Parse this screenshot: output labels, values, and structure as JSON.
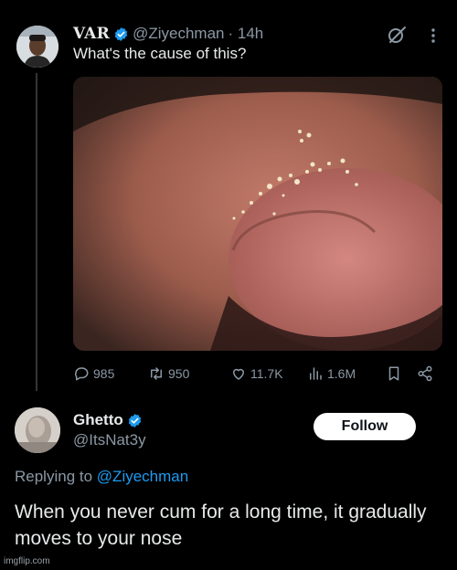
{
  "tweet": {
    "author_name": "VAR",
    "handle": "@Ziyechman",
    "time": "· 14h",
    "text": "What's the cause of this?",
    "stats": {
      "replies": "985",
      "retweets": "950",
      "likes": "11.7K",
      "views": "1.6M"
    }
  },
  "reply": {
    "author_name": "Ghetto",
    "handle": "@ItsNat3y",
    "follow_label": "Follow",
    "replying_prefix": "Replying to",
    "replying_mention": "@Ziyechman",
    "text": "When you never cum for a long time, it gradually moves to your nose"
  },
  "watermark": "imgflip.com",
  "colors": {
    "background": "#000000",
    "text_primary": "#e7e9ea",
    "text_secondary": "#8b98a5",
    "accent": "#1d9bf0",
    "verified": "#1d9bf0"
  },
  "icons": [
    "verified-badge-icon",
    "grok-icon",
    "more-icon",
    "reply-icon",
    "retweet-icon",
    "like-icon",
    "views-icon",
    "bookmark-icon",
    "share-icon"
  ]
}
